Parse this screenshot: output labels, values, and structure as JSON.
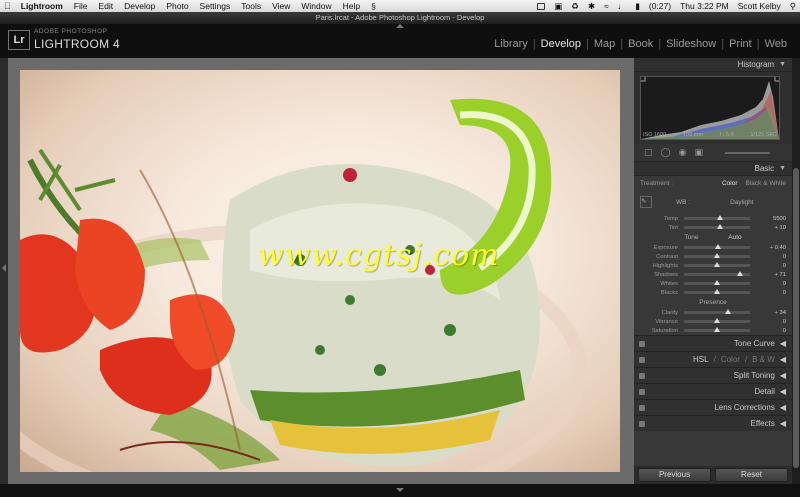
{
  "menubar": {
    "app": "Lightroom",
    "items": [
      "File",
      "Edit",
      "Develop",
      "Photo",
      "Settings",
      "Tools",
      "View",
      "Window",
      "Help"
    ],
    "battery": "(0:27)",
    "clock": "Thu 3:22 PM",
    "user": "Scott Kelby"
  },
  "window": {
    "title": "Paris.lrcat - Adobe Photoshop Lightroom - Develop"
  },
  "header": {
    "logo": "Lr",
    "brand_small": "ADOBE PHOTOSHOP",
    "brand_big": "LIGHTROOM 4",
    "modules": [
      "Library",
      "Develop",
      "Map",
      "Book",
      "Slideshow",
      "Print",
      "Web"
    ],
    "active_module": "Develop"
  },
  "photo": {
    "watermark": "www.cgtsj.com"
  },
  "panel": {
    "histogram": {
      "title": "Histogram",
      "iso": "ISO 1600",
      "focal": "100 mm",
      "aperture": "f / 5.6",
      "shutter": "1/125 SEC"
    },
    "basic": {
      "title": "Basic",
      "treatment_label": "Treatment :",
      "treatment_color": "Color",
      "treatment_bw": "Black & White",
      "wb_label": "WB :",
      "wb_value": "Daylight",
      "tone_label": "Tone",
      "auto_label": "Auto",
      "presence_label": "Presence",
      "sliders_wb": [
        {
          "label": "Temp",
          "value": "5500",
          "pos": 0.55
        },
        {
          "label": "Tint",
          "value": "+ 10",
          "pos": 0.55
        }
      ],
      "sliders_tone": [
        {
          "label": "Exposure",
          "value": "+ 0.40",
          "pos": 0.52
        },
        {
          "label": "Contrast",
          "value": "0",
          "pos": 0.5
        },
        {
          "label": "Highlights",
          "value": "0",
          "pos": 0.5
        },
        {
          "label": "Shadows",
          "value": "+ 71",
          "pos": 0.85
        },
        {
          "label": "Whites",
          "value": "0",
          "pos": 0.5
        },
        {
          "label": "Blacks",
          "value": "0",
          "pos": 0.5
        }
      ],
      "sliders_presence": [
        {
          "label": "Clarity",
          "value": "+ 34",
          "pos": 0.67
        },
        {
          "label": "Vibrance",
          "value": "0",
          "pos": 0.5
        },
        {
          "label": "Saturation",
          "value": "0",
          "pos": 0.5
        }
      ]
    },
    "collapsed": {
      "tone_curve": "Tone Curve",
      "hsl": "HSL",
      "hsl_sep1": "/",
      "color": "Color",
      "hsl_sep2": "/",
      "bw": "B & W",
      "split_toning": "Split Toning",
      "detail": "Detail",
      "lens_corrections": "Lens Corrections",
      "effects": "Effects"
    },
    "buttons": {
      "previous": "Previous",
      "reset": "Reset"
    }
  }
}
